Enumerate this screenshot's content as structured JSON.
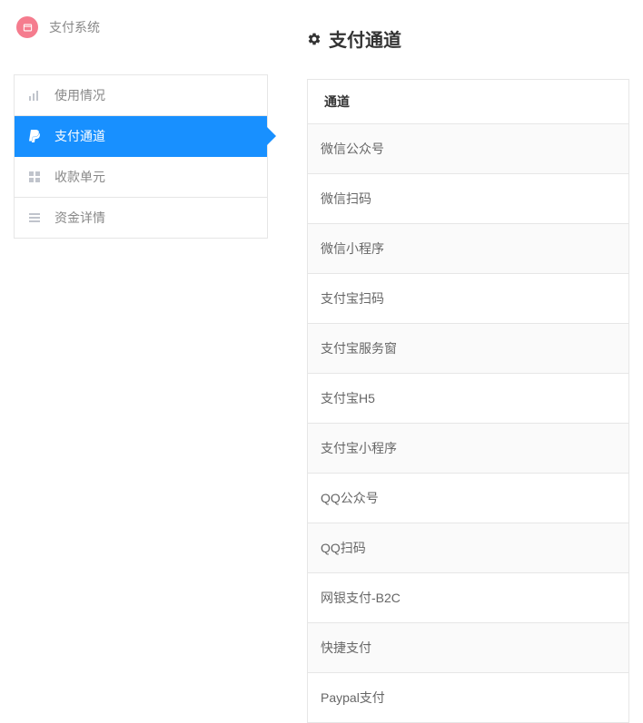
{
  "app": {
    "title": "支付系统"
  },
  "sidebar": {
    "items": [
      {
        "label": "使用情况",
        "active": false
      },
      {
        "label": "支付通道",
        "active": true
      },
      {
        "label": "收款单元",
        "active": false
      },
      {
        "label": "资金详情",
        "active": false
      }
    ]
  },
  "main": {
    "title": "支付通道",
    "table": {
      "header": "通道",
      "rows": [
        "微信公众号",
        "微信扫码",
        "微信小程序",
        "支付宝扫码",
        "支付宝服务窗",
        "支付宝H5",
        "支付宝小程序",
        "QQ公众号",
        "QQ扫码",
        "网银支付-B2C",
        "快捷支付",
        "Paypal支付"
      ]
    }
  }
}
